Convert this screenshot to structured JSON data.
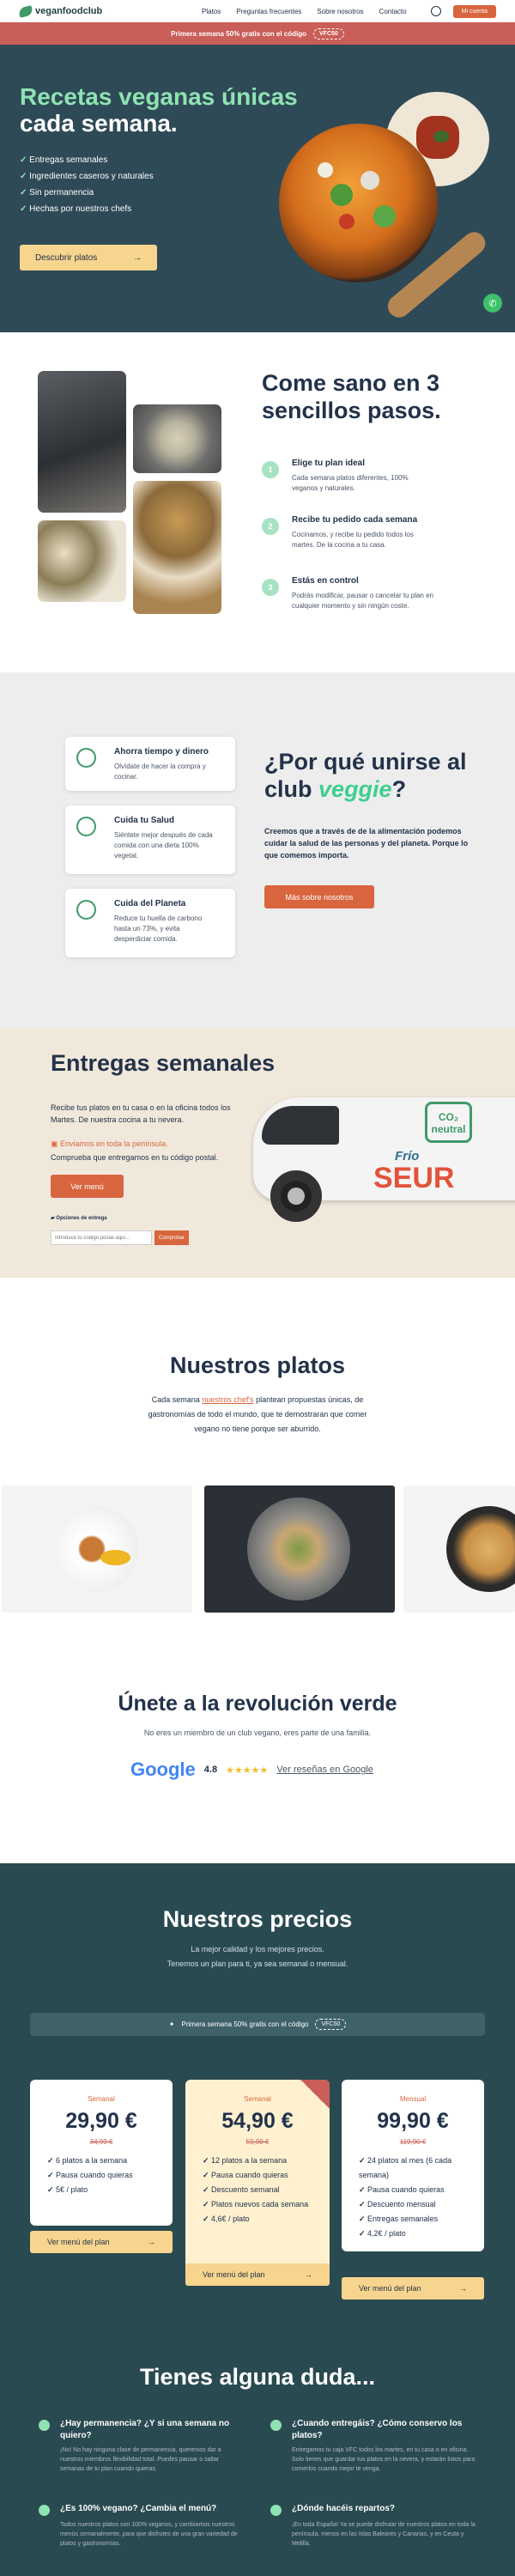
{
  "nav": {
    "logo": "veganfoodclub",
    "links": [
      "Platos",
      "Preguntas frecuentes",
      "Sobre nosotros",
      "Contacto"
    ],
    "cta": "Mi cuenta"
  },
  "promo": {
    "text": "Primera semana 50% gratis con el código",
    "code": "VFC50"
  },
  "hero": {
    "title_green": "Recetas veganas únicas",
    "title_white": "cada semana.",
    "bullets": [
      "Entregas semanales",
      "Ingredientes caseros y naturales",
      "Sin permanencia",
      "Hechas por nuestros chefs"
    ],
    "cta": "Descubrir platos",
    "cta_icon": "arrow-right-icon"
  },
  "steps": {
    "title": "Come sano en 3 sencillos pasos.",
    "items": [
      {
        "num": "1",
        "title": "Elige tu plan ideal",
        "text": "Cada semana platos diferentes, 100% veganos y naturales."
      },
      {
        "num": "2",
        "title": "Recibe tu pedido cada semana",
        "text": "Cocinamos, y recibe tu pedido todos los martes. De la cocina a tu casa."
      },
      {
        "num": "3",
        "title": "Estás en control",
        "text": "Podrás modificar, pausar o cancelar tu plan en cualquier momento y sin ningún coste."
      }
    ]
  },
  "why": {
    "title_a": "¿Por qué unirse al club",
    "title_b": "veggie",
    "title_c": "?",
    "text": "Creemos que a través de de la alimentación podemos cuidar la salud de las personas y del planeta. Porque lo que comemos importa.",
    "cta": "Más sobre nosotros",
    "cards": [
      {
        "icon": "clock-icon",
        "title": "Ahorra tiempo y dinero",
        "text": "Olvídate de hacer la compra y cocinar."
      },
      {
        "icon": "heart-icon",
        "title": "Cuida tu Salud",
        "text": "Siéntete mejor después de cada comida con una dieta 100% vegetal."
      },
      {
        "icon": "globe-icon",
        "title": "Cuida del Planeta",
        "text": "Reduce tu huella de carbono hasta un 73%, y evita desperdiciar comida."
      }
    ]
  },
  "delivery": {
    "title": "Entregas semanales",
    "text": "Recibe tus platos en tu casa o en la oficina todos los Martes. De nuestra cocina a tu nevera.",
    "highlight": "Enviamos en toda la península.",
    "check": "Comprueba que entregamos en tu código postal.",
    "cta": "Ver menú",
    "options_label": "Opciones de entrega",
    "zip_placeholder": "Introduce tu código postal aquí...",
    "zip_button": "Comprobar",
    "van_brand": "SEUR",
    "van_frio": "Frío",
    "van_co2": "CO₂ neutral"
  },
  "dishes": {
    "title": "Nuestros platos",
    "text_a": "Cada semana",
    "text_link": "nuestros chef's",
    "text_b": "plantean propuestas únicas, de gastronomías de todo el mundo, que te demostraran que comer vegano no tiene porque ser aburrido."
  },
  "reviews": {
    "title": "Únete a la revolución verde",
    "sub": "No eres un miembro de un club vegano, eres parte de una familia.",
    "google": "Google",
    "rating": "4.8",
    "stars": "★★★★★",
    "link": "Ver reseñas en Google"
  },
  "prices": {
    "title": "Nuestros precios",
    "sub1": "La mejor calidad y los mejores precios.",
    "sub2": "Tenemos un plan para ti, ya sea semanal o mensual.",
    "promo_text": "Primera semana 50% gratis con el código",
    "promo_code": "VFC50",
    "plans": [
      {
        "tag": "Semanal",
        "price": "29,90 €",
        "old": "34,99 €",
        "features": [
          "6 platos a la semana",
          "Pausa cuando quieras",
          "5€ / plato"
        ],
        "cta": "Ver menú del plan"
      },
      {
        "tag": "Semanal",
        "price": "54,90 €",
        "old": "59,90 €",
        "features": [
          "12 platos a la semana",
          "Pausa cuando quieras",
          "Descuento semanal",
          "Platos nuevos cada semana",
          "4,6€ / plato"
        ],
        "cta": "Ver menú del plan"
      },
      {
        "tag": "Mensual",
        "price": "99,90 €",
        "old": "119,90 €",
        "features": [
          "24 platos al mes (6 cada semana)",
          "Pausa cuando quieras",
          "Descuento mensual",
          "Entregas semanales",
          "4,2€ / plato"
        ],
        "cta": "Ver menú del plan"
      }
    ]
  },
  "faq": {
    "title": "Tienes alguna duda...",
    "items": [
      {
        "q": "¿Hay permanencia? ¿Y si una semana no quiero?",
        "a": "¡No! No hay ninguna clase de permanencia, queremos dar a nuestros miembros flexibilidad total. Puedes pausar o saltar semanas de tu plan cuando quieras."
      },
      {
        "q": "¿Cuando entregáis? ¿Cómo conservo los platos?",
        "a": "Entregamos tu caja VFC todos los martes, en tu casa o en oficina. Solo tienes que guardar tus platos en la nevera, y estarán listos para comerlos cuando mejor te venga."
      },
      {
        "q": "¿Es 100% vegano? ¿Cambia el menú?",
        "a": "Todos nuestros platos son 100% veganos, y cambiamos nuestros menús semanalmente, para que disfrutes de una gran variedad de platos y gastronomías."
      },
      {
        "q": "¿Dónde hacéis repartos?",
        "a": "¡En toda España! Ya se puede disfrutar de nuestros platos en toda la península, menos en las Islas Baleares y Canarias, y en Ceuta y Melilla."
      }
    ]
  }
}
